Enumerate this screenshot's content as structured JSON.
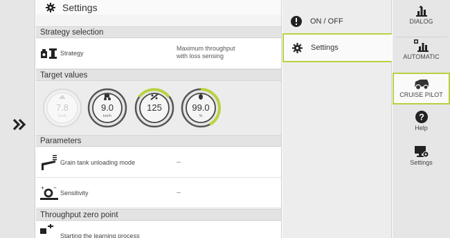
{
  "settings_panel": {
    "title": "Settings",
    "strategy_section": "Strategy selection",
    "strategy": {
      "label": "Strategy",
      "value_line1": "Maximum throughput",
      "value_line2": "with loss sensing"
    },
    "target_section": "Target values",
    "gauges": [
      {
        "value": "7.8",
        "unit": "km/h",
        "icon": "throughput-icon",
        "state": "inactive"
      },
      {
        "value": "9.0",
        "unit": "km/h",
        "icon": "harvester-speed-icon",
        "state": "active"
      },
      {
        "value": "125",
        "unit": "",
        "icon": "rotor-loss-icon",
        "state": "active"
      },
      {
        "value": "99.0",
        "unit": "%",
        "icon": "grain-loss-icon",
        "state": "active"
      }
    ],
    "parameters_section": "Parameters",
    "grain_tank": {
      "label": "Grain tank unloading mode",
      "value": "--"
    },
    "sensitivity": {
      "label": "Sensitivity",
      "value": "--"
    },
    "zero_section": "Throughput zero point",
    "learning": {
      "label": "Starting the learning process"
    }
  },
  "menu": {
    "items": [
      {
        "label": "ON / OFF",
        "icon": "info-icon"
      },
      {
        "label": "Settings",
        "icon": "gear-icon"
      }
    ]
  },
  "right_nav": {
    "items": [
      {
        "label": "DIALOG",
        "icon": "bar-chart-icon"
      },
      {
        "label": "AUTOMATIC",
        "icon": "auto-chart-icon"
      },
      {
        "label": "CRUISE PILOT",
        "icon": "harvester-icon"
      },
      {
        "label": "Help",
        "icon": "help-icon"
      },
      {
        "label": "Settings",
        "icon": "monitor-settings-icon"
      }
    ]
  },
  "colors": {
    "accent": "#b7d240",
    "gauge_ring": "#555555",
    "background": "#f4f4f4"
  }
}
